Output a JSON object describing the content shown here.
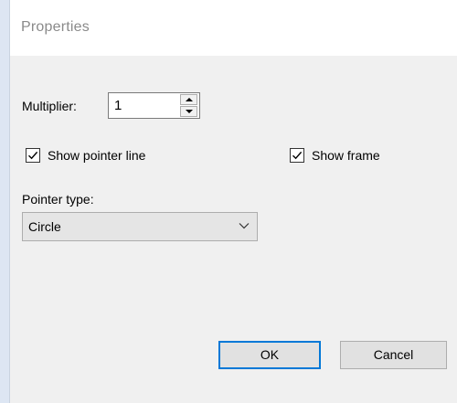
{
  "window": {
    "title": "Properties"
  },
  "multiplier": {
    "label": "Multiplier:",
    "value": "1"
  },
  "show_pointer_line": {
    "label": "Show pointer line",
    "checked": true
  },
  "show_frame": {
    "label": "Show frame",
    "checked": true
  },
  "pointer_type": {
    "label": "Pointer type:",
    "selected": "Circle"
  },
  "buttons": {
    "ok": "OK",
    "cancel": "Cancel"
  },
  "colors": {
    "background_outer": "#dde6f3",
    "dialog": "#f0f0f0",
    "titlebar": "#ffffff",
    "title_text": "#8a8a8a",
    "default_button_border": "#0078d7"
  }
}
